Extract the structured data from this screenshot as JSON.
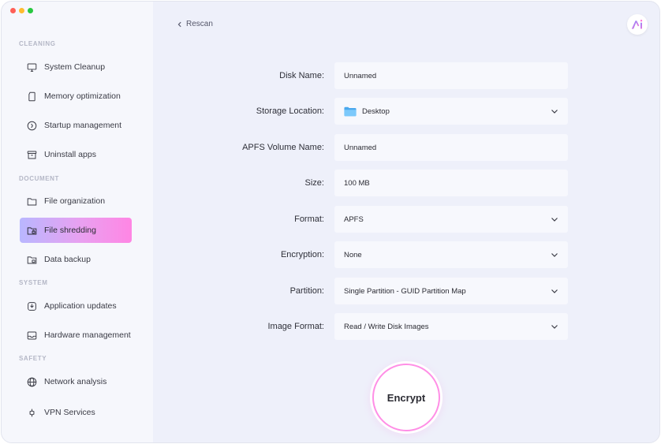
{
  "sidebar": {
    "sections": {
      "cleaning": "CLEANING",
      "document": "DOCUMENT",
      "system": "SYSTEM",
      "safety": "SAFETY"
    },
    "items": [
      {
        "label": "System Cleanup",
        "icon": "monitor-icon"
      },
      {
        "label": "Memory optimization",
        "icon": "memory-card-icon"
      },
      {
        "label": "Startup management",
        "icon": "clock-icon"
      },
      {
        "label": "Uninstall apps",
        "icon": "archive-box-icon"
      },
      {
        "label": "File organization",
        "icon": "folder-icon"
      },
      {
        "label": "File shredding",
        "icon": "folder-lock-icon",
        "active": true
      },
      {
        "label": "Data backup",
        "icon": "folder-backup-icon"
      },
      {
        "label": "Application updates",
        "icon": "update-icon"
      },
      {
        "label": "Hardware management",
        "icon": "inbox-icon"
      },
      {
        "label": "Network analysis",
        "icon": "globe-icon"
      },
      {
        "label": "VPN Services",
        "icon": "vpn-icon"
      }
    ]
  },
  "header": {
    "back_label": "Rescan"
  },
  "form": {
    "disk_name": {
      "label": "Disk Name:",
      "value": "Unnamed"
    },
    "storage_location": {
      "label": "Storage Location:",
      "value": "Desktop"
    },
    "apfs_volume_name": {
      "label": "APFS Volume Name:",
      "value": "Unnamed"
    },
    "size": {
      "label": "Size:",
      "value": "100 MB"
    },
    "format": {
      "label": "Format:",
      "value": "APFS"
    },
    "encryption": {
      "label": "Encryption:",
      "value": "None"
    },
    "partition": {
      "label": "Partition:",
      "value": "Single Partition - GUID Partition Map"
    },
    "image_format": {
      "label": "Image Format:",
      "value": "Read / Write Disk Images"
    }
  },
  "action": {
    "encrypt_label": "Encrypt"
  },
  "colors": {
    "accent_start": "#b9b7ff",
    "accent_end": "#ff86e4",
    "folder_blue": "#5ab8f5"
  }
}
